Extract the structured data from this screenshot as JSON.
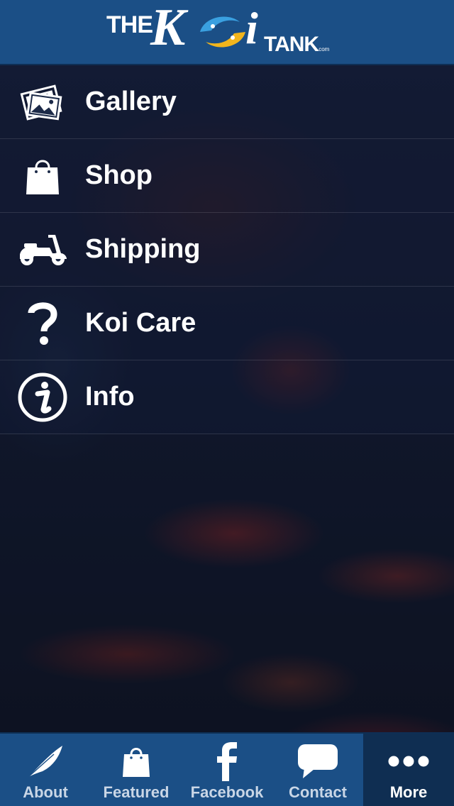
{
  "header": {
    "logo_the": "THE",
    "logo_k": "K",
    "logo_i": "i",
    "logo_tank": "TANK",
    "logo_com": ".com"
  },
  "menu": {
    "items": [
      {
        "label": "Gallery",
        "icon": "gallery-icon"
      },
      {
        "label": "Shop",
        "icon": "shopping-bag-icon"
      },
      {
        "label": "Shipping",
        "icon": "scooter-icon"
      },
      {
        "label": "Koi Care",
        "icon": "question-mark-icon"
      },
      {
        "label": "Info",
        "icon": "info-icon"
      }
    ]
  },
  "tabbar": {
    "tabs": [
      {
        "label": "About",
        "icon": "feather-icon"
      },
      {
        "label": "Featured",
        "icon": "shopping-bag-icon"
      },
      {
        "label": "Facebook",
        "icon": "facebook-icon"
      },
      {
        "label": "Contact",
        "icon": "speech-bubble-icon"
      },
      {
        "label": "More",
        "icon": "more-dots-icon",
        "active": true
      }
    ]
  },
  "colors": {
    "bar_blue": "#1b4f86",
    "active_tab": "#0f2e52",
    "fish_blue": "#3aa0e0",
    "fish_gold": "#f2b51c"
  }
}
